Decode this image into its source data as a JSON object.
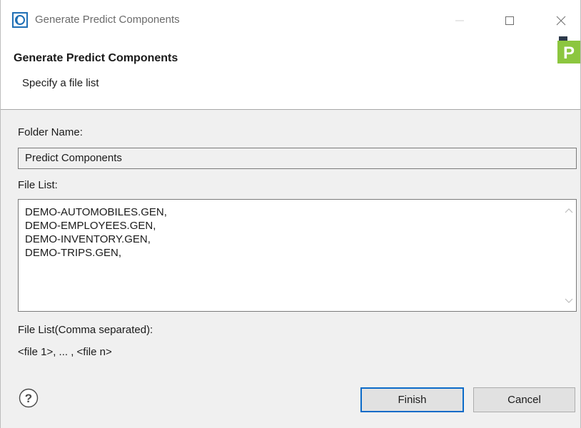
{
  "window": {
    "title": "Generate Predict Components",
    "controls": {
      "minimize": "minimize-icon",
      "maximize": "maximize-icon",
      "close": "close-icon"
    }
  },
  "banner": {
    "title": "Generate Predict Components",
    "description": "Specify a file list",
    "logo_letter": "P",
    "logo_color": "#8cc63f"
  },
  "form": {
    "folder_label": "Folder Name:",
    "folder_value": "Predict Components",
    "filelist_label": "File List:",
    "filelist_lines": [
      "DEMO-AUTOMOBILES.GEN,",
      "DEMO-EMPLOYEES.GEN,",
      "DEMO-INVENTORY.GEN,",
      "DEMO-TRIPS.GEN,"
    ],
    "hint_label": "File List(Comma separated):",
    "hint_value": "<file 1>, ... , <file n>"
  },
  "footer": {
    "help_icon": "help-icon",
    "finish_label": "Finish",
    "cancel_label": "Cancel",
    "accent_color": "#0b6bc8"
  }
}
